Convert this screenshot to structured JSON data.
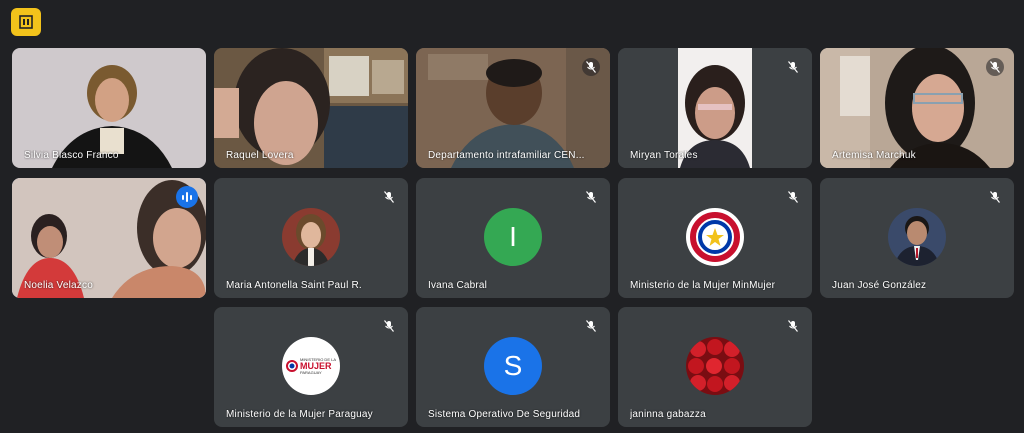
{
  "app": {
    "badge_icon": "meeting-info-icon",
    "badge_color": "#f2c21b"
  },
  "participants": [
    {
      "name": "Silvia Blasco Franco"
    },
    {
      "name": "Raquel Lovera"
    },
    {
      "name": "Departamento intrafamiliar CEN..."
    },
    {
      "name": "Miryan Torales"
    },
    {
      "name": "Artemisa Marchuk"
    },
    {
      "name": "Noelia Velazco"
    },
    {
      "name": "Maria Antonella Saint Paul R."
    },
    {
      "name": "Ivana Cabral",
      "initial": "I",
      "color": "#34a853"
    },
    {
      "name": "Ministerio de la Mujer MinMujer"
    },
    {
      "name": "Juan José González"
    },
    {
      "name": "Ministerio de la Mujer Paraguay",
      "logo_text": [
        "MINISTERIO DE LA",
        "MUJER",
        "PARAGUAY"
      ]
    },
    {
      "name": "Sistema Operativo De Seguridad",
      "initial": "S",
      "color": "#1a73e8"
    },
    {
      "name": "janinna gabazza"
    }
  ]
}
